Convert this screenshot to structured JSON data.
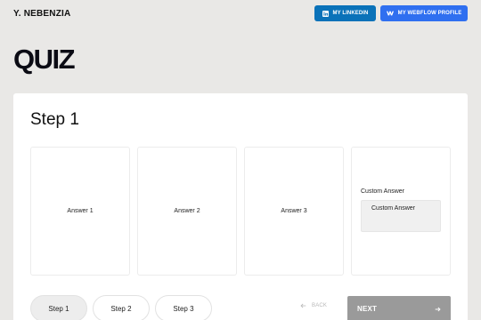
{
  "header": {
    "brand": "Y. NEBENZIA",
    "linkedin_label": "MY LINKEDIN",
    "webflow_label": "MY WEBFLOW PROFILE"
  },
  "page_title": "QUIZ",
  "quiz": {
    "step_title": "Step 1",
    "answers": [
      "Answer 1",
      "Answer 2",
      "Answer 3"
    ],
    "custom_label": "Custom Answer",
    "custom_value": "Custom Answer"
  },
  "steps": [
    "Step 1",
    "Step 2",
    "Step 3"
  ],
  "nav": {
    "back_label": "BACK",
    "next_label": "NEXT"
  },
  "colors": {
    "linkedin": "#0a72b9",
    "webflow": "#2f6ff0",
    "next_button": "#9a9a9a"
  }
}
